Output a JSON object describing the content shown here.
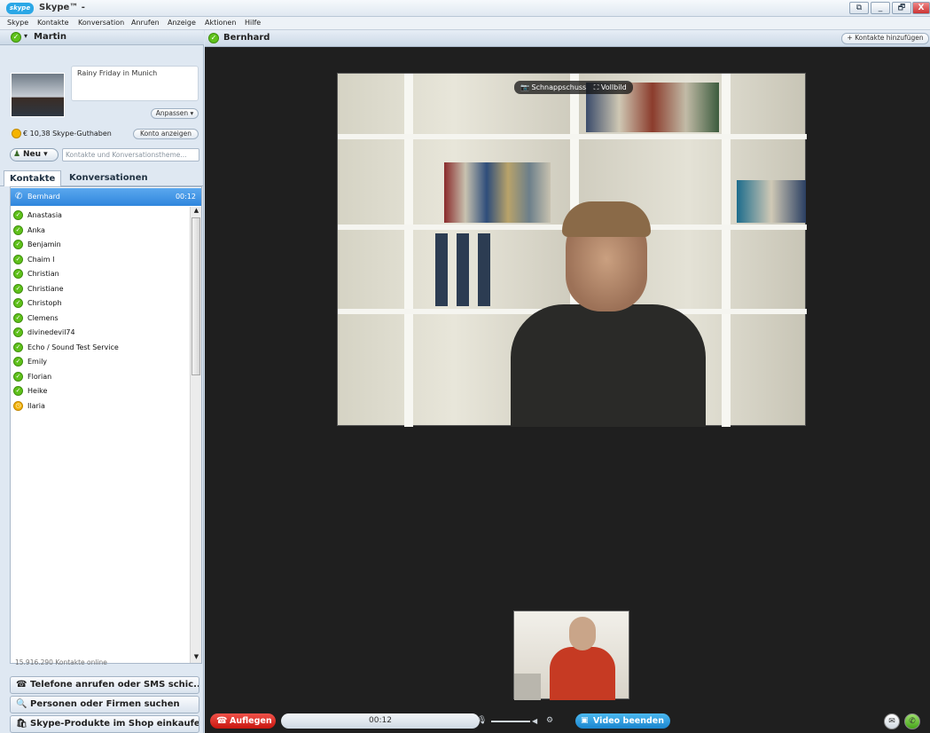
{
  "window": {
    "title": "Skype™ -",
    "logo_text": "skype",
    "btn_restore": "⧉",
    "btn_min": "_",
    "btn_max": "🗗",
    "btn_close": "X"
  },
  "menu": [
    "Skype",
    "Kontakte",
    "Konversation",
    "Anrufen",
    "Anzeige",
    "Aktionen",
    "Hilfe"
  ],
  "profile": {
    "name": "Martin",
    "mood": "Rainy Friday in Munich",
    "customize_button": "Anpassen ▾"
  },
  "credit": {
    "text": "€ 10,38 Skype-Guthaben",
    "account_button": "Konto anzeigen"
  },
  "search": {
    "new_button": "Neu ▾",
    "placeholder": "Kontakte und Konversationstheme..."
  },
  "tabs": {
    "contacts": "Kontakte",
    "conversations": "Konversationen"
  },
  "active_call": {
    "name": "Bernhard",
    "time": "00:12"
  },
  "contacts": [
    {
      "name": "Anastasia",
      "status": "online"
    },
    {
      "name": "Anka",
      "status": "online"
    },
    {
      "name": "Benjamin",
      "status": "online"
    },
    {
      "name": "Chaim I",
      "status": "online"
    },
    {
      "name": "Christian",
      "status": "online"
    },
    {
      "name": "Christiane",
      "status": "online"
    },
    {
      "name": "Christoph",
      "status": "online"
    },
    {
      "name": "Clemens",
      "status": "online"
    },
    {
      "name": "divinedevil74",
      "status": "online"
    },
    {
      "name": "Echo / Sound Test Service",
      "status": "online"
    },
    {
      "name": "Emily",
      "status": "online"
    },
    {
      "name": "Florian",
      "status": "online"
    },
    {
      "name": "Heike",
      "status": "online"
    },
    {
      "name": "Ilaria",
      "status": "away"
    }
  ],
  "contacts_online": "15.916.290 Kontakte online",
  "actions": {
    "phones": "Telefone anrufen oder SMS schic...",
    "search_people": "Personen oder Firmen suchen",
    "shop": "Skype-Produkte im Shop einkaufen"
  },
  "conversation": {
    "name": "Bernhard",
    "add_contacts": "+ Kontakte hinzufügen",
    "snapshot": "📷 Schnappschuss",
    "fullscreen": "⛶ Vollbild"
  },
  "call_controls": {
    "hangup": "Auflegen",
    "timer": "00:12",
    "video_end": "Video beenden"
  },
  "colors": {
    "accent": "#2f86dd",
    "online": "#5fc11b",
    "away": "#f2b100",
    "hangup": "#c8160f"
  },
  "icons": [
    "skype-logo-icon",
    "status-online-icon",
    "phone-icon",
    "coin-icon",
    "add-contact-icon",
    "search-icon",
    "shop-icon",
    "camera-icon",
    "fullscreen-icon",
    "hangup-icon",
    "mic-icon",
    "video-icon",
    "chat-icon",
    "call-icon"
  ]
}
